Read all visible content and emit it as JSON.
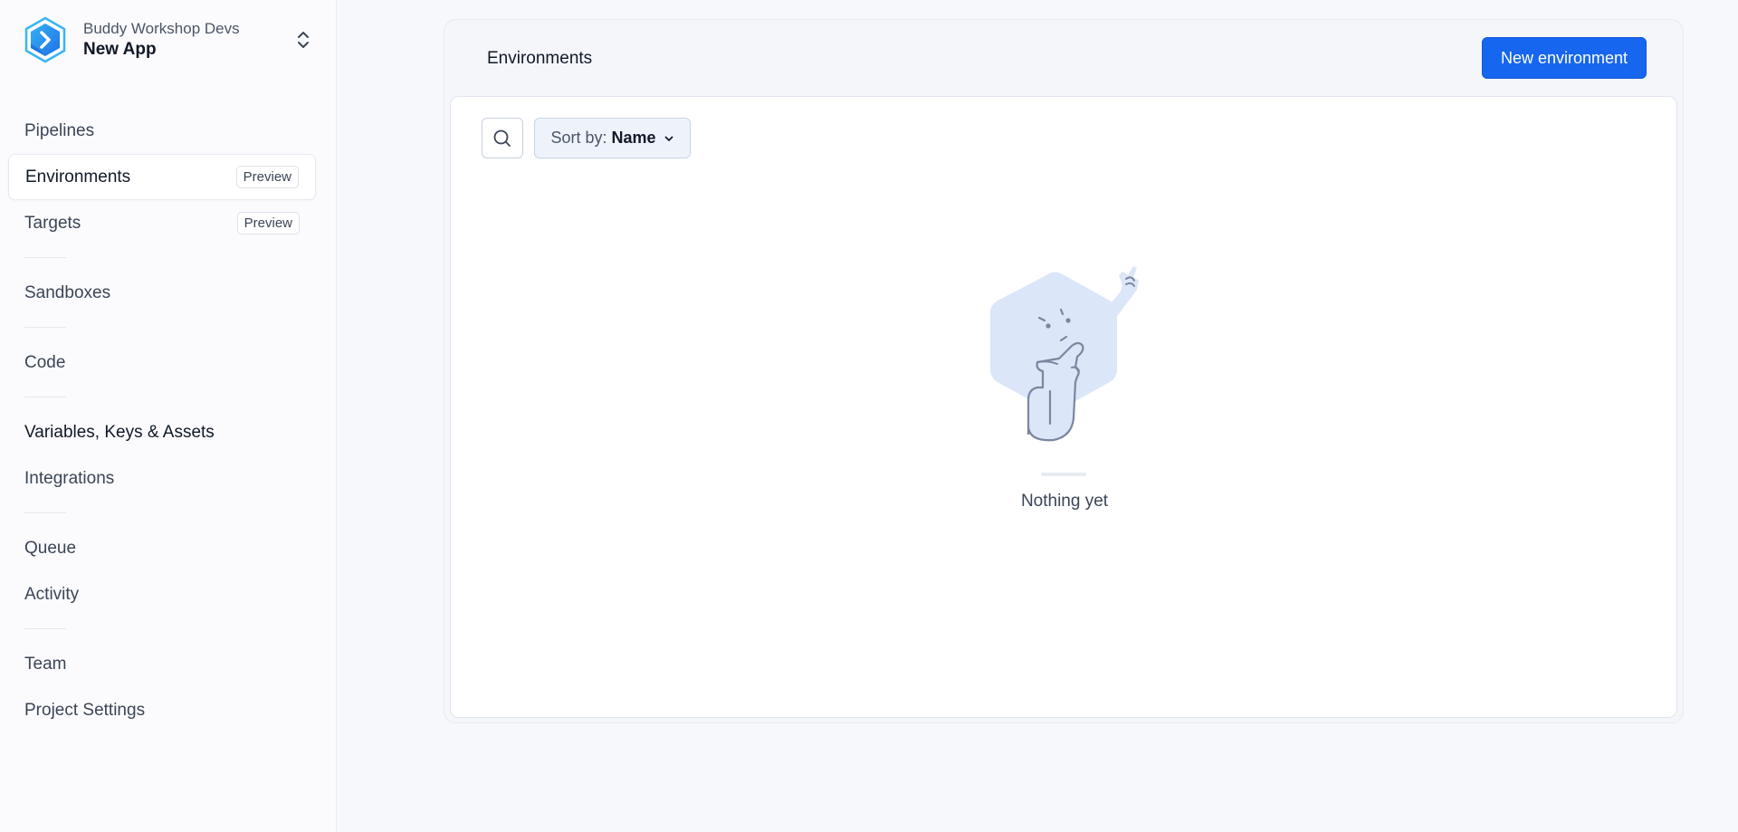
{
  "project": {
    "workspace": "Buddy Workshop Devs",
    "name": "New App"
  },
  "sidebar": {
    "items": [
      {
        "label": "Pipelines"
      },
      {
        "label": "Environments",
        "badge": "Preview"
      },
      {
        "label": "Targets",
        "badge": "Preview"
      },
      {
        "label": "Sandboxes"
      },
      {
        "label": "Code"
      },
      {
        "label": "Variables, Keys & Assets"
      },
      {
        "label": "Integrations"
      },
      {
        "label": "Queue"
      },
      {
        "label": "Activity"
      },
      {
        "label": "Team"
      },
      {
        "label": "Project Settings"
      }
    ]
  },
  "main": {
    "title": "Environments",
    "new_button": "New environment",
    "sort": {
      "prefix": "Sort by:",
      "value": "Name"
    },
    "empty_text": "Nothing yet"
  },
  "colors": {
    "accent": "#1766f0",
    "illustration": "#dbe6f8",
    "line": "#7b86a0"
  },
  "icons": {
    "search": "search-icon",
    "switch": "chevron-up-down-icon",
    "sort": "chevron-down-icon",
    "logo": "buddy-logo"
  }
}
